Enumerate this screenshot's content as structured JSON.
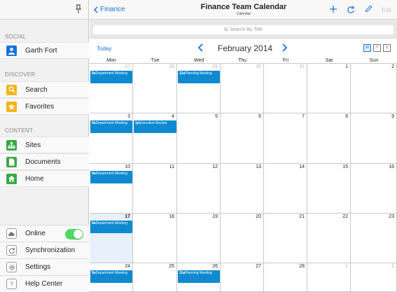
{
  "sidebar": {
    "sections": {
      "social": "SOCIAL",
      "discover": "DISCOVER",
      "content": "CONTENT"
    },
    "user": {
      "name": "Garth Fort"
    },
    "discover_items": [
      {
        "label": "Search",
        "icon": "search-icon"
      },
      {
        "label": "Favorites",
        "icon": "star-icon"
      }
    ],
    "content_items": [
      {
        "label": "Sites",
        "icon": "sites-icon"
      },
      {
        "label": "Documents",
        "icon": "document-icon"
      },
      {
        "label": "Home",
        "icon": "home-icon"
      }
    ],
    "bottom_items": [
      {
        "label": "Online",
        "icon": "cloud-icon"
      },
      {
        "label": "Synchronization",
        "icon": "sync-icon"
      },
      {
        "label": "Settings",
        "icon": "gear-icon"
      },
      {
        "label": "Help Center",
        "icon": "help-icon"
      }
    ],
    "online_enabled": true
  },
  "header": {
    "back_label": "Finance",
    "title": "Finance Team Calendar",
    "subtitle": "Calendar",
    "edit_label": "Edit"
  },
  "search": {
    "placeholder": "Search By Title"
  },
  "nav": {
    "today_label": "Today",
    "month": "February 2014",
    "view_buttons": [
      "30",
      "7",
      "1"
    ]
  },
  "calendar": {
    "weekdays": [
      "Mon",
      "Tue",
      "Wed",
      "Thu",
      "Fri",
      "Sat",
      "Sun"
    ],
    "weeks": [
      [
        {
          "d": "27",
          "muted": true
        },
        {
          "d": "28",
          "muted": true
        },
        {
          "d": "29",
          "muted": true
        },
        {
          "d": "30",
          "muted": true
        },
        {
          "d": "31",
          "muted": true
        },
        {
          "d": "1"
        },
        {
          "d": "2"
        }
      ],
      [
        {
          "d": "3"
        },
        {
          "d": "4"
        },
        {
          "d": "5"
        },
        {
          "d": "6"
        },
        {
          "d": "7"
        },
        {
          "d": "8"
        },
        {
          "d": "9"
        }
      ],
      [
        {
          "d": "10"
        },
        {
          "d": "11"
        },
        {
          "d": "12"
        },
        {
          "d": "13"
        },
        {
          "d": "14"
        },
        {
          "d": "15"
        },
        {
          "d": "16"
        }
      ],
      [
        {
          "d": "17",
          "today": true
        },
        {
          "d": "18"
        },
        {
          "d": "19"
        },
        {
          "d": "20"
        },
        {
          "d": "21"
        },
        {
          "d": "22"
        },
        {
          "d": "23"
        }
      ],
      [
        {
          "d": "24"
        },
        {
          "d": "25"
        },
        {
          "d": "26"
        },
        {
          "d": "27"
        },
        {
          "d": "28"
        },
        {
          "d": "1",
          "muted": true
        },
        {
          "d": "2",
          "muted": true
        }
      ]
    ],
    "events": [
      {
        "week": 0,
        "day": 0,
        "time": "9a",
        "title": "Department Meeting"
      },
      {
        "week": 0,
        "day": 2,
        "time": "11a",
        "title": "Planning Meeting"
      },
      {
        "week": 1,
        "day": 0,
        "time": "9a",
        "title": "Department Meeting"
      },
      {
        "week": 1,
        "day": 1,
        "time": "1p",
        "title": "Executive Review"
      },
      {
        "week": 2,
        "day": 0,
        "time": "9a",
        "title": "Department Meeting"
      },
      {
        "week": 3,
        "day": 0,
        "time": "9a",
        "title": "Department Meeting"
      },
      {
        "week": 4,
        "day": 0,
        "time": "9a",
        "title": "Department Meeting"
      },
      {
        "week": 4,
        "day": 2,
        "time": "11a",
        "title": "Planning Meeting"
      }
    ]
  },
  "colors": {
    "accent": "#1a73d9",
    "event": "#0f8ad1",
    "toggle_on": "#4cd964",
    "search_icon_bg": "#f5b31b",
    "favorites_icon_bg": "#f5b31b",
    "content_icon_bg": "#3aa845",
    "avatar_bg": "#1a73d9"
  }
}
